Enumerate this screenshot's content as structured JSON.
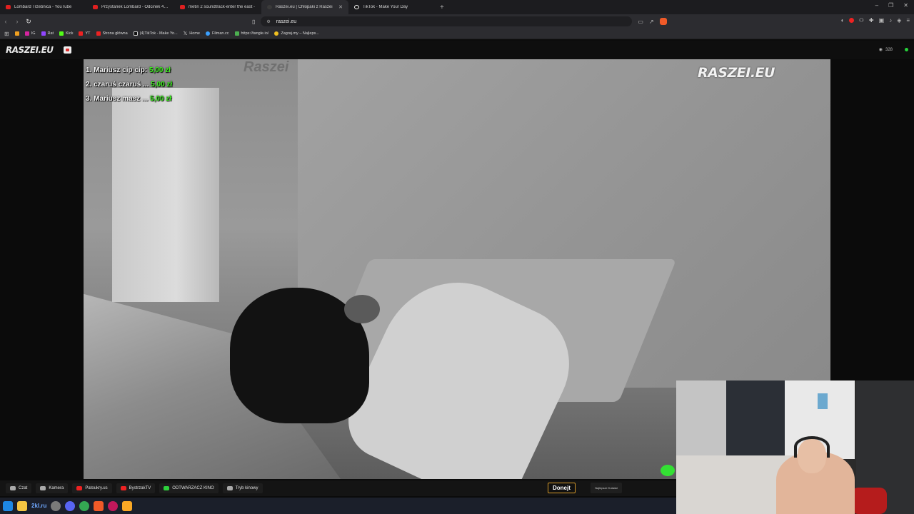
{
  "tabs": [
    {
      "title": "Lombard Trzebnica - YouTube",
      "icon": "youtube-icon"
    },
    {
      "title": "Przystanek Lombard - Odcinek 4. \"Cl",
      "icon": "youtube-icon"
    },
    {
      "title": "metin 2 soundtrack-enter the east -",
      "icon": "youtube-icon"
    },
    {
      "title": "Raszei.eu | Chłopaki z Raszei",
      "icon": "raszei-icon",
      "active": true
    },
    {
      "title": "TikTok - Make Your Day",
      "icon": "tiktok-icon"
    }
  ],
  "address": {
    "url": "raszei.eu"
  },
  "bookmarks": [
    "IG",
    "Rat",
    "Kick",
    "YT",
    "Strona główna",
    "(4)TikTok - Make Yo...",
    "Home",
    "Filman.cc",
    "https://tangle.io/",
    "Zagraj.my – Najleps..."
  ],
  "site": {
    "logo": "RASZEI.EU",
    "viewers": "328"
  },
  "overlay": {
    "leaderboard": [
      {
        "rank": "1.",
        "name": "Mariusz cip cip:",
        "amount": "5,00 zł"
      },
      {
        "rank": "2.",
        "name": "czaruś czaruś ...",
        "amount": "5,00 zł"
      },
      {
        "rank": "3.",
        "name": "Mariusz masz ...",
        "amount": "5,00 zł"
      }
    ],
    "watermark": "RASZEI.EU",
    "faint_mark": "Raszei"
  },
  "bottombar": {
    "buttons": [
      "Czat",
      "Kamera",
      "Patoukry.us",
      "BystrzakTV",
      "ODTWARZACZ KINO",
      "Tryb kinowy"
    ],
    "donate": "Donejt",
    "najlepsze": "Najlepsze Kutaski"
  },
  "taskbar": {
    "text": "2kl.ru"
  },
  "colors": {
    "accent_green": "#3df21f",
    "live_dot": "#26d23a",
    "donate_border": "#d69a2a"
  }
}
